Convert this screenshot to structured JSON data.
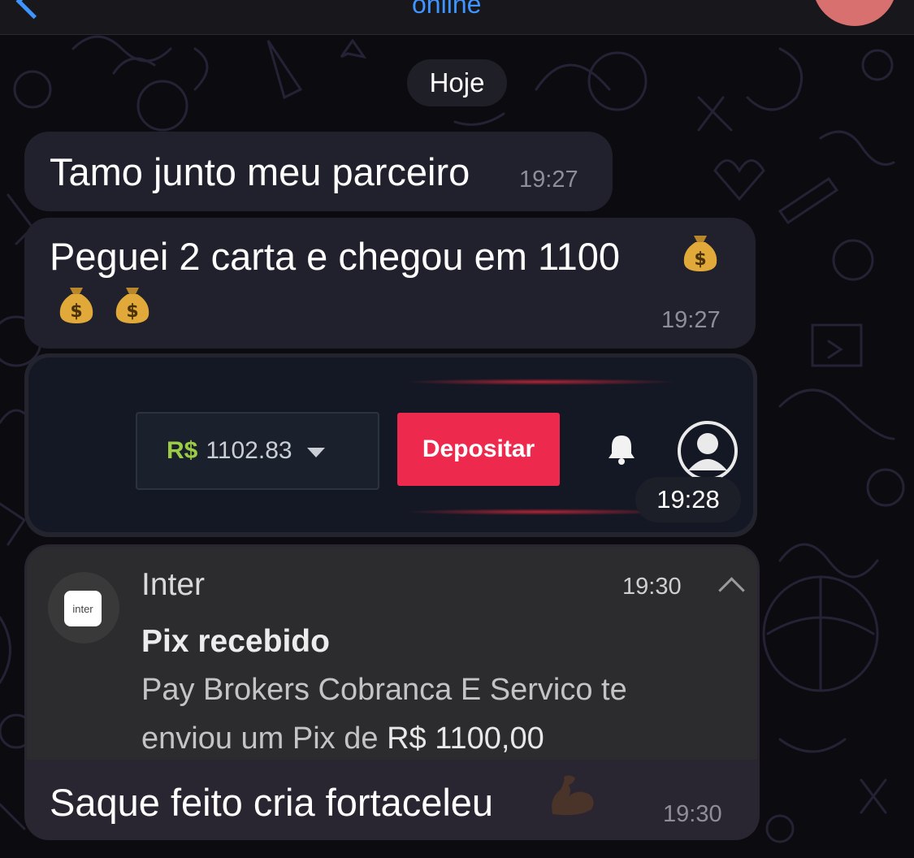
{
  "header": {
    "status": "online"
  },
  "date_pill": "Hoje",
  "messages": [
    {
      "text": "Tamo junto meu parceiro",
      "time": "19:27"
    },
    {
      "text": "Peguei 2 carta e chegou em 1100",
      "time": "19:27",
      "emoji": "money-bag"
    }
  ],
  "image_message": {
    "time": "19:28",
    "balance_currency": "R$",
    "balance_value": "1102.83",
    "deposit_label": "Depositar"
  },
  "notification_message": {
    "app_icon_text": "inter",
    "app_name": "Inter",
    "time": "19:30",
    "title": "Pix recebido",
    "body_line1": "Pay Brokers Cobranca E Servico te",
    "body_line2_prefix": "enviou um Pix de ",
    "body_amount": "R$ 1100,00",
    "caption": "Saque feito cria fortaceleu",
    "caption_time": "19:30",
    "caption_emoji": "flexed-biceps"
  },
  "colors": {
    "accent": "#3e95ff",
    "bubble": "#20212c",
    "deposit": "#ed2a4e",
    "currency_green": "#9ccc45"
  }
}
